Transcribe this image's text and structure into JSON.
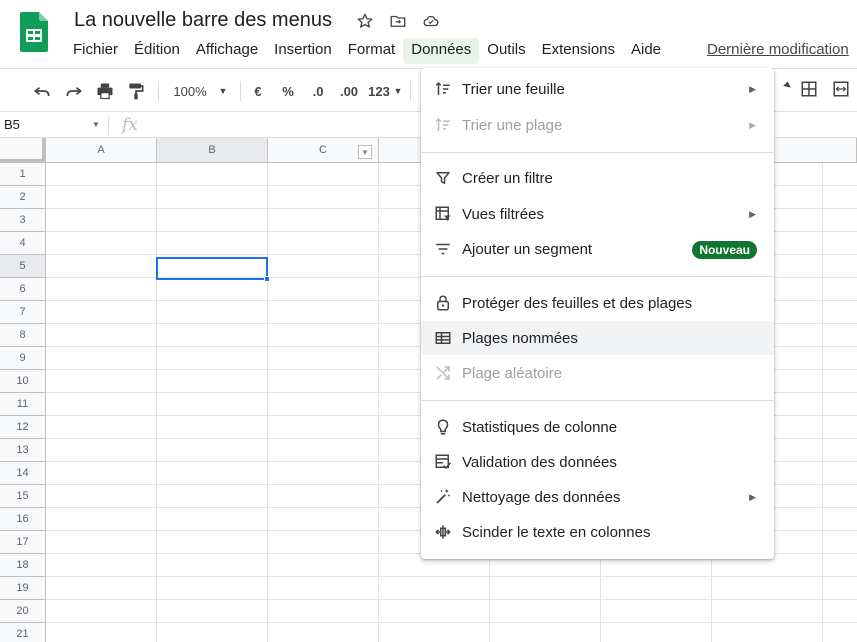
{
  "document": {
    "title": "La nouvelle barre des menus",
    "last_edit": "Dernière modification"
  },
  "menubar": {
    "items": [
      "Fichier",
      "Édition",
      "Affichage",
      "Insertion",
      "Format",
      "Données",
      "Outils",
      "Extensions",
      "Aide"
    ],
    "active": "Données"
  },
  "toolbar": {
    "zoom": "100%",
    "currency": "€",
    "percent": "%",
    "decrease_decimals": ".0",
    "increase_decimals": ".00",
    "format_more": "123"
  },
  "formula_bar": {
    "name_box": "B5",
    "fx": "fx"
  },
  "grid": {
    "columns": [
      "A",
      "B",
      "C"
    ],
    "rows": [
      "1",
      "2",
      "3",
      "4",
      "5",
      "6",
      "7",
      "8",
      "9",
      "10",
      "11",
      "12",
      "13",
      "14",
      "15",
      "16",
      "17",
      "18",
      "19",
      "20",
      "21"
    ],
    "selected_cell": "B5"
  },
  "dropdown": {
    "items": [
      {
        "label": "Trier une feuille",
        "icon": "sort-icon",
        "submenu": true,
        "disabled": false
      },
      {
        "label": "Trier une plage",
        "icon": "sort-icon",
        "submenu": true,
        "disabled": true
      },
      {
        "label": "Créer un filtre",
        "icon": "filter-icon",
        "submenu": false,
        "disabled": false
      },
      {
        "label": "Vues filtrées",
        "icon": "filter-views-icon",
        "submenu": true,
        "disabled": false
      },
      {
        "label": "Ajouter un segment",
        "icon": "slicer-icon",
        "submenu": false,
        "disabled": false,
        "badge": "Nouveau"
      },
      {
        "label": "Protéger des feuilles et des plages",
        "icon": "lock-icon",
        "submenu": false,
        "disabled": false
      },
      {
        "label": "Plages nommées",
        "icon": "named-ranges-icon",
        "submenu": false,
        "disabled": false,
        "hover": true
      },
      {
        "label": "Plage aléatoire",
        "icon": "shuffle-icon",
        "submenu": false,
        "disabled": true
      },
      {
        "label": "Statistiques de colonne",
        "icon": "lightbulb-icon",
        "submenu": false,
        "disabled": false
      },
      {
        "label": "Validation des données",
        "icon": "validation-icon",
        "submenu": false,
        "disabled": false
      },
      {
        "label": "Nettoyage des données",
        "icon": "magic-wand-icon",
        "submenu": true,
        "disabled": false
      },
      {
        "label": "Scinder le texte en colonnes",
        "icon": "split-icon",
        "submenu": false,
        "disabled": false
      }
    ]
  },
  "colors": {
    "accent": "#1a73e8",
    "badge": "#137333",
    "active_menu": "#e6f4ea",
    "sheets_green": "#0f9d58"
  }
}
